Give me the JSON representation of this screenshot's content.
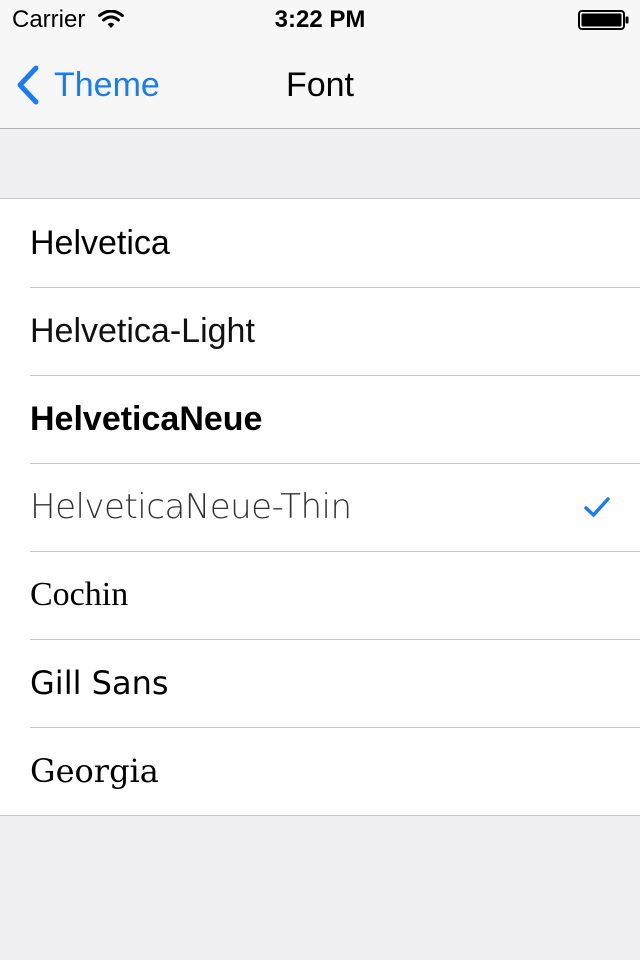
{
  "status_bar": {
    "carrier": "Carrier",
    "time": "3:22 PM"
  },
  "nav": {
    "back_label": "Theme",
    "title": "Font"
  },
  "fonts": [
    {
      "label": "Helvetica",
      "selected": false
    },
    {
      "label": "Helvetica-Light",
      "selected": false
    },
    {
      "label": "HelveticaNeue",
      "selected": false
    },
    {
      "label": "HelveticaNeue-Thin",
      "selected": true
    },
    {
      "label": "Cochin",
      "selected": false
    },
    {
      "label": "Gill Sans",
      "selected": false
    },
    {
      "label": "Georgia",
      "selected": false
    }
  ],
  "colors": {
    "accent": "#1a7cf2",
    "background": "#efeff4",
    "separator": "#c8c7cc"
  },
  "icons": {
    "wifi": "wifi-icon",
    "battery": "battery-icon",
    "back": "chevron-left-icon",
    "check": "checkmark-icon"
  }
}
